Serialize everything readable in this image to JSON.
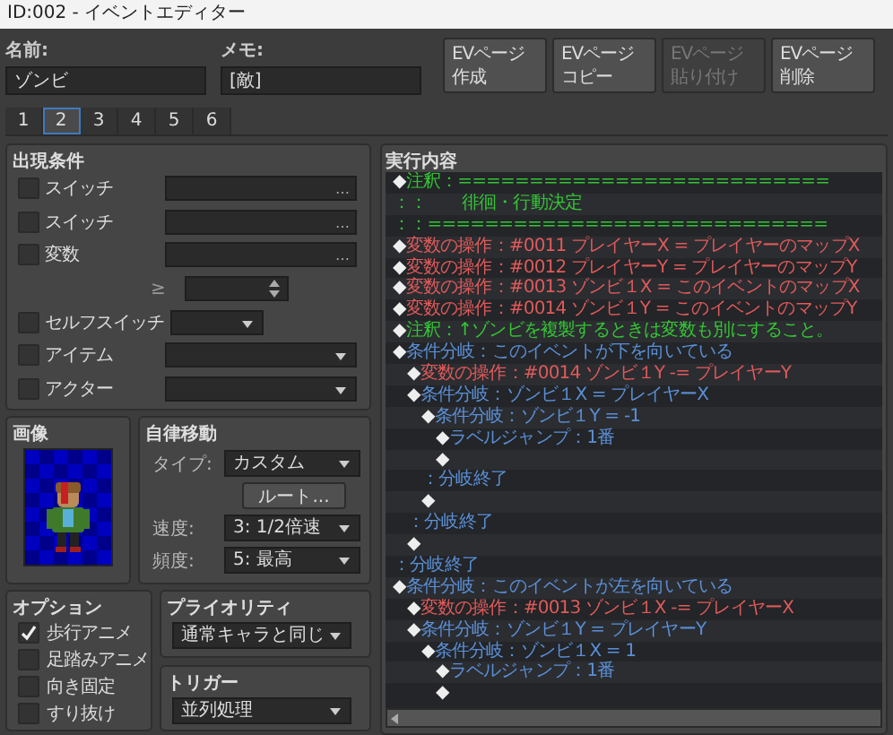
{
  "window": {
    "title": "ID:002 - イベントエディター"
  },
  "name": {
    "label": "名前:",
    "value": "ゾンビ"
  },
  "memo": {
    "label": "メモ:",
    "value": "[敵]"
  },
  "page_buttons": [
    {
      "lines": [
        "EVページ",
        "作成"
      ],
      "disabled": false
    },
    {
      "lines": [
        "EVページ",
        "コピー"
      ],
      "disabled": false
    },
    {
      "lines": [
        "EVページ",
        "貼り付け"
      ],
      "disabled": true
    },
    {
      "lines": [
        "EVページ",
        "削除"
      ],
      "disabled": false
    }
  ],
  "tabs": [
    {
      "label": "1",
      "selected": false
    },
    {
      "label": "2",
      "selected": true
    },
    {
      "label": "3",
      "selected": false
    },
    {
      "label": "4",
      "selected": false
    },
    {
      "label": "5",
      "selected": false
    },
    {
      "label": "6",
      "selected": false
    }
  ],
  "conditions": {
    "title": "出現条件",
    "items": [
      {
        "kind": "picker",
        "label": "スイッチ",
        "checked": false,
        "button": "…"
      },
      {
        "kind": "picker",
        "label": "スイッチ",
        "checked": false,
        "button": "…"
      },
      {
        "kind": "picker",
        "label": "変数",
        "checked": false,
        "button": "…"
      },
      {
        "kind": "number",
        "label": "≥"
      },
      {
        "kind": "small_dropdown",
        "label": "セルフスイッチ",
        "checked": false
      },
      {
        "kind": "dropdown",
        "label": "アイテム",
        "checked": false
      },
      {
        "kind": "dropdown",
        "label": "アクター",
        "checked": false
      }
    ]
  },
  "image": {
    "title": "画像"
  },
  "movement": {
    "title": "自律移動",
    "type_label": "タイプ:",
    "type": "カスタム",
    "route_button": "ルート...",
    "speed_label": "速度:",
    "speed": "3: 1/2倍速",
    "frequency_label": "頻度:",
    "frequency": "5: 最高"
  },
  "options": {
    "title": "オプション",
    "items": [
      {
        "label": "歩行アニメ",
        "checked": true
      },
      {
        "label": "足踏みアニメ",
        "checked": false
      },
      {
        "label": "向き固定",
        "checked": false
      },
      {
        "label": "すり抜け",
        "checked": false
      }
    ]
  },
  "priority": {
    "title": "プライオリティ",
    "value": "通常キャラと同じ"
  },
  "trigger": {
    "title": "トリガー",
    "value": "並列処理"
  },
  "contents": {
    "title": "実行内容",
    "commands": [
      {
        "kind": "comment",
        "marker": "◆",
        "text": "注釈：=========================="
      },
      {
        "kind": "comment",
        "marker": "：",
        "text": "：　　徘徊・行動決定"
      },
      {
        "kind": "comment",
        "marker": "：",
        "text": "：============================"
      },
      {
        "kind": "variable",
        "marker": "◆",
        "text": "変数の操作：#0011 プレイヤーX = プレイヤーのマップX"
      },
      {
        "kind": "variable",
        "marker": "◆",
        "text": "変数の操作：#0012 プレイヤーY = プレイヤーのマップY"
      },
      {
        "kind": "variable",
        "marker": "◆",
        "text": "変数の操作：#0013 ゾンビ１X = このイベントのマップX"
      },
      {
        "kind": "variable",
        "marker": "◆",
        "text": "変数の操作：#0014 ゾンビ１Y = このイベントのマップY"
      },
      {
        "kind": "comment",
        "marker": "◆",
        "text": "注釈：↑ゾンビを複製するときは変数も別にすること。"
      },
      {
        "kind": "branch",
        "marker": "◆",
        "text": "条件分岐：このイベントが下を向いている",
        "children": [
          {
            "kind": "variable",
            "marker": "◆",
            "text": "変数の操作：#0014 ゾンビ１Y -= プレイヤーY"
          },
          {
            "kind": "branch",
            "marker": "◆",
            "text": "条件分岐：ゾンビ１X = プレイヤーX",
            "children": [
              {
                "kind": "branch",
                "marker": "◆",
                "text": "条件分岐：ゾンビ１Y = -1",
                "children": [
                  {
                    "kind": "branch",
                    "marker": "◆",
                    "text": "ラベルジャンプ：1番"
                  },
                  {
                    "marker": "◆"
                  }
                ]
              },
              {
                "kind": "branch",
                "marker": "：",
                "text": "分岐終了"
              },
              {
                "marker": "◆"
              }
            ]
          },
          {
            "kind": "branch",
            "marker": "：",
            "text": "分岐終了"
          },
          {
            "marker": "◆"
          }
        ]
      },
      {
        "kind": "branch",
        "marker": "：",
        "text": "分岐終了"
      },
      {
        "kind": "branch",
        "marker": "◆",
        "text": "条件分岐：このイベントが左を向いている",
        "children": [
          {
            "kind": "variable",
            "marker": "◆",
            "text": "変数の操作：#0013 ゾンビ１X -= プレイヤーX"
          },
          {
            "kind": "branch",
            "marker": "◆",
            "text": "条件分岐：ゾンビ１Y = プレイヤーY",
            "children": [
              {
                "kind": "branch",
                "marker": "◆",
                "text": "条件分岐：ゾンビ１X = 1",
                "children": [
                  {
                    "kind": "branch",
                    "marker": "◆",
                    "text": "ラベルジャンプ：1番"
                  },
                  {
                    "marker": "◆"
                  }
                ]
              }
            ]
          }
        ]
      }
    ]
  }
}
